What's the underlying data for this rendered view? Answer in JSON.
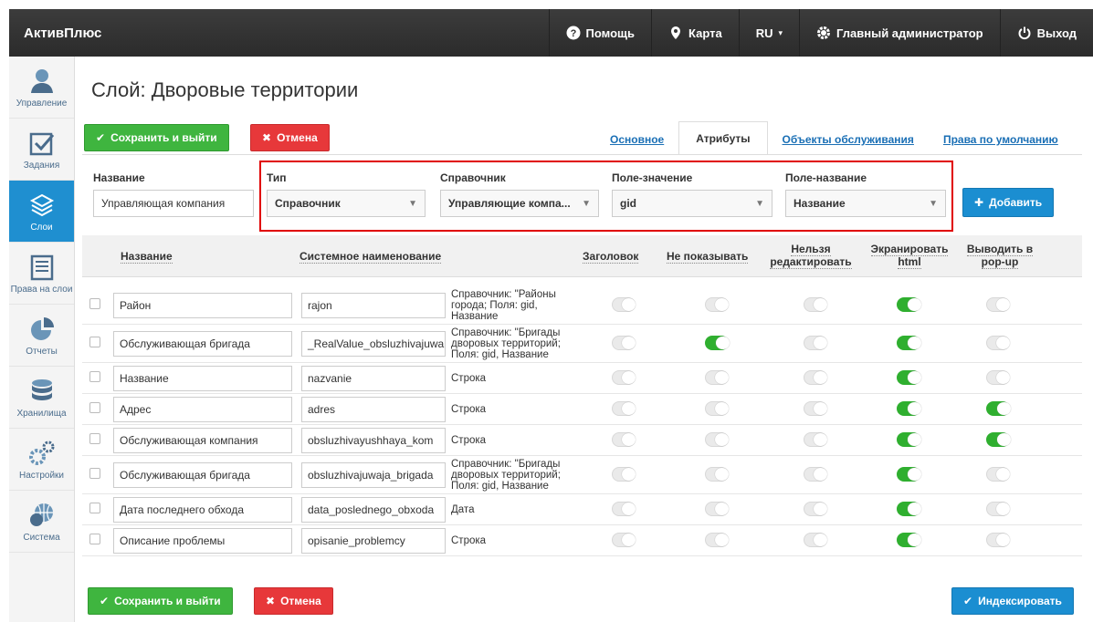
{
  "topbar": {
    "brand": "АктивПлюс",
    "help": "Помощь",
    "map": "Карта",
    "lang": "RU",
    "admin": "Главный администратор",
    "logout": "Выход"
  },
  "sidebar": {
    "items": [
      {
        "label": "Управление",
        "icon": "user-icon",
        "active": false
      },
      {
        "label": "Задания",
        "icon": "checkbox-icon",
        "active": false
      },
      {
        "label": "Слои",
        "icon": "layers-icon",
        "active": true
      },
      {
        "label": "Права на слои",
        "icon": "list-icon",
        "active": false
      },
      {
        "label": "Отчеты",
        "icon": "pie-chart-icon",
        "active": false
      },
      {
        "label": "Хранилища",
        "icon": "database-icon",
        "active": false
      },
      {
        "label": "Настройки",
        "icon": "gears-icon",
        "active": false
      },
      {
        "label": "Система",
        "icon": "globe-icon",
        "active": false
      }
    ]
  },
  "page": {
    "title": "Слой: Дворовые территории",
    "save_label": "Сохранить и выйти",
    "cancel_label": "Отмена",
    "add_label": "Добавить",
    "index_label": "Индексировать"
  },
  "tabs": [
    {
      "label": "Основное",
      "active": false
    },
    {
      "label": "Атрибуты",
      "active": true
    },
    {
      "label": "Объекты обслуживания",
      "active": false
    },
    {
      "label": "Права по умолчанию",
      "active": false
    }
  ],
  "form": {
    "name_label": "Название",
    "name_value": "Управляющая компания",
    "type_label": "Тип",
    "type_value": "Справочник",
    "ref_label": "Справочник",
    "ref_value": "Управляющие компа...",
    "value_field_label": "Поле-значение",
    "value_field_value": "gid",
    "name_field_label": "Поле-название",
    "name_field_value": "Название"
  },
  "table": {
    "headers": {
      "name": "Название",
      "system_name": "Системное наименование",
      "title": "Заголовок",
      "hide": "Не показывать",
      "readonly": "Нельзя редактировать",
      "escape": "Экранировать html",
      "popup": "Выводить в pop-up"
    },
    "rows": [
      {
        "name": "Район",
        "system": "rajon",
        "type": "Справочник: \"Районы города; Поля: gid, Название",
        "title": false,
        "hide": false,
        "readonly": false,
        "escape": true,
        "popup": false
      },
      {
        "name": "Обслуживающая бригада",
        "system": "_RealValue_obsluzhivajuwa",
        "type": "Справочник: \"Бригады дворовых территорий; Поля: gid, Название",
        "title": false,
        "hide": true,
        "readonly": false,
        "escape": true,
        "popup": false
      },
      {
        "name": "Название",
        "system": "nazvanie",
        "type": "Строка",
        "title": false,
        "hide": false,
        "readonly": false,
        "escape": true,
        "popup": false
      },
      {
        "name": "Адрес",
        "system": "adres",
        "type": "Строка",
        "title": false,
        "hide": false,
        "readonly": false,
        "escape": true,
        "popup": true
      },
      {
        "name": "Обслуживающая компания",
        "system": "obsluzhivayushhaya_kom",
        "type": "Строка",
        "title": false,
        "hide": false,
        "readonly": false,
        "escape": true,
        "popup": true
      },
      {
        "name": "Обслуживающая бригада",
        "system": "obsluzhivajuwaja_brigada",
        "type": "Справочник: \"Бригады дворовых территорий; Поля: gid, Название",
        "title": false,
        "hide": false,
        "readonly": false,
        "escape": true,
        "popup": false
      },
      {
        "name": "Дата последнего обхода",
        "system": "data_poslednego_obxoda",
        "type": "Дата",
        "title": false,
        "hide": false,
        "readonly": false,
        "escape": true,
        "popup": false
      },
      {
        "name": "Описание проблемы",
        "system": "opisanie_problemcy",
        "type": "Строка",
        "title": false,
        "hide": false,
        "readonly": false,
        "escape": true,
        "popup": false
      }
    ]
  },
  "colors": {
    "green": "#3fb53f",
    "red": "#e7383a",
    "blue": "#1b8ed1",
    "toggle_on": "#2faf2f",
    "highlight": "#e00000"
  }
}
